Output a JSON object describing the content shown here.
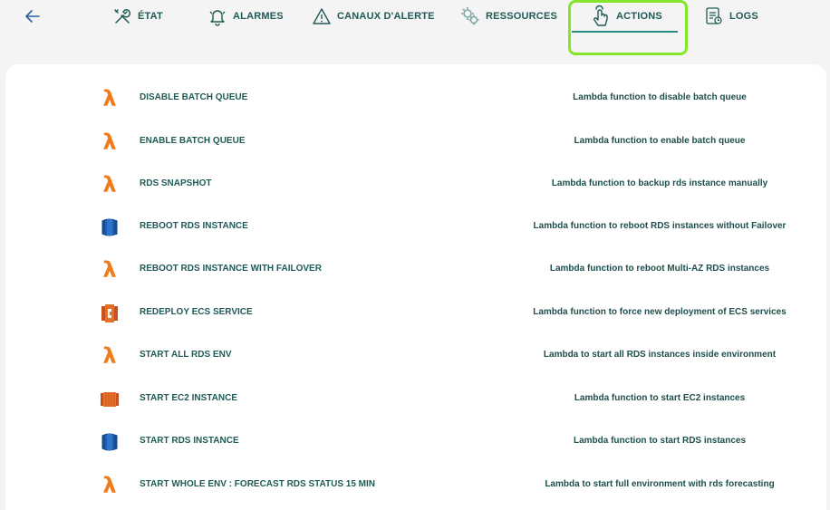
{
  "nav": {
    "tabs": [
      {
        "label": "ÉTAT",
        "icon": "wrench-tools-icon"
      },
      {
        "label": "ALARMES",
        "icon": "bell-icon"
      },
      {
        "label": "CANAUX D'ALERTE",
        "icon": "warning-triangle-icon"
      },
      {
        "label": "RESSOURCES",
        "icon": "gears-icon"
      },
      {
        "label": "ACTIONS",
        "icon": "tap-hand-icon",
        "active": true
      },
      {
        "label": "LOGS",
        "icon": "log-file-icon"
      }
    ]
  },
  "actions": [
    {
      "name": "DISABLE BATCH QUEUE",
      "description": "Lambda function to disable batch queue",
      "icon": "lambda-icon"
    },
    {
      "name": "ENABLE BATCH QUEUE",
      "description": "Lambda function to enable batch queue",
      "icon": "lambda-icon"
    },
    {
      "name": "RDS SNAPSHOT",
      "description": "Lambda function to backup rds instance manually",
      "icon": "lambda-icon"
    },
    {
      "name": "REBOOT RDS INSTANCE",
      "description": "Lambda function to reboot RDS instances without Failover",
      "icon": "rds-database-icon"
    },
    {
      "name": "REBOOT RDS INSTANCE WITH FAILOVER",
      "description": "Lambda function to reboot Multi-AZ RDS instances",
      "icon": "lambda-icon"
    },
    {
      "name": "REDEPLOY ECS SERVICE",
      "description": "Lambda function to force new deployment of ECS services",
      "icon": "ecs-service-icon"
    },
    {
      "name": "START ALL RDS ENV",
      "description": "Lambda to start all RDS instances inside environment",
      "icon": "lambda-icon"
    },
    {
      "name": "START EC2 INSTANCE",
      "description": "Lambda function to start EC2 instances",
      "icon": "ec2-instance-icon"
    },
    {
      "name": "START RDS INSTANCE",
      "description": "Lambda function to start RDS instances",
      "icon": "rds-database-icon"
    },
    {
      "name": "START WHOLE ENV : FORECAST RDS STATUS 15 MIN",
      "description": "Lambda to start full environment with rds forecasting",
      "icon": "lambda-icon"
    }
  ],
  "colors": {
    "accent": "#1f5a56",
    "highlight": "#84e52a",
    "lambda": "#f07b19",
    "rds": "#1f5fb4"
  }
}
